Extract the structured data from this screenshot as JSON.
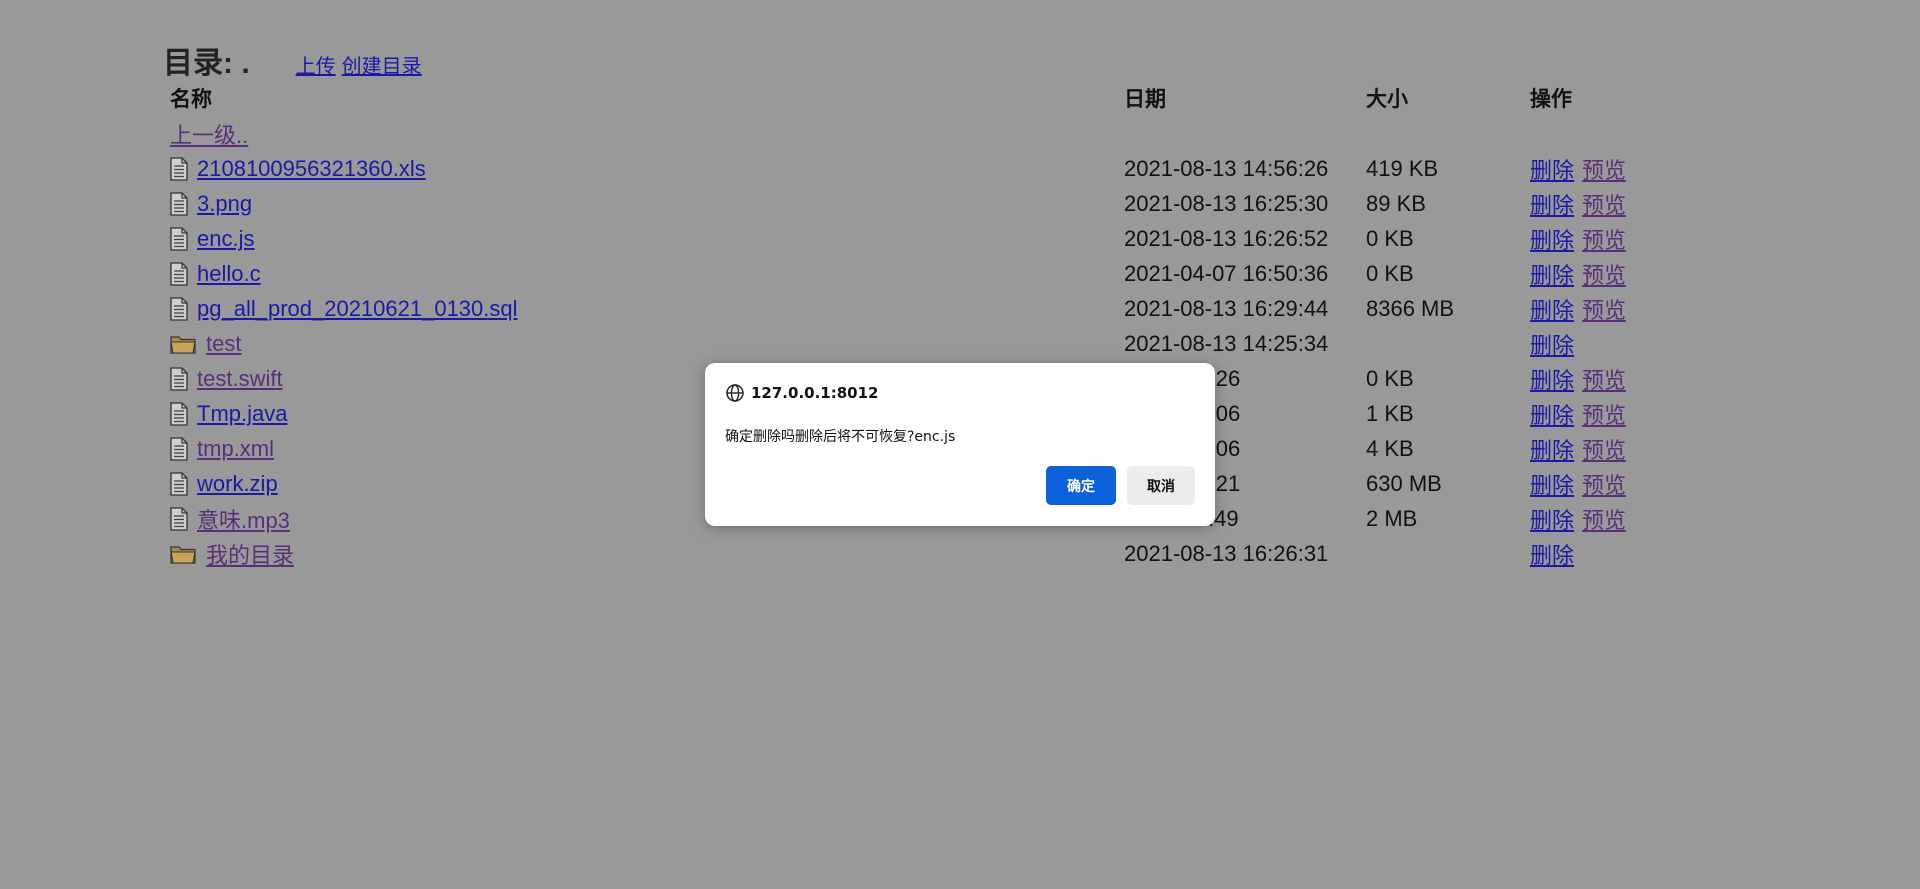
{
  "header": {
    "title": "目录: .",
    "upload_link": "上传",
    "mkdir_link": "创建目录"
  },
  "table": {
    "columns": [
      "名称",
      "日期",
      "大小",
      "操作"
    ],
    "parent_link": "上一级..",
    "rows": [
      {
        "type": "file",
        "name": "2108100956321360.xls",
        "date": "2021-08-13 14:56:26",
        "size": "419 KB",
        "delete": "删除",
        "preview": "预览",
        "visited": false
      },
      {
        "type": "file",
        "name": "3.png",
        "date": "2021-08-13 16:25:30",
        "size": "89 KB",
        "delete": "删除",
        "preview": "预览",
        "visited": false
      },
      {
        "type": "file",
        "name": "enc.js",
        "date": "2021-08-13 16:26:52",
        "size": "0 KB",
        "delete": "删除",
        "preview": "预览",
        "visited": false
      },
      {
        "type": "file",
        "name": "hello.c",
        "date": "2021-04-07 16:50:36",
        "size": "0 KB",
        "delete": "删除",
        "preview": "预览",
        "visited": false
      },
      {
        "type": "file",
        "name": "pg_all_prod_20210621_0130.sql",
        "date": "2021-08-13 16:29:44",
        "size": "8366 MB",
        "delete": "删除",
        "preview": "预览",
        "visited": false
      },
      {
        "type": "folder",
        "name": "test",
        "date": "2021-08-13 14:25:34",
        "size": "",
        "delete": "删除",
        "preview": "",
        "visited": true
      },
      {
        "type": "file",
        "name": "test.swift",
        "date": "21 09:35:26",
        "size": "0 KB",
        "delete": "删除",
        "preview": "预览",
        "visited": true
      },
      {
        "type": "file",
        "name": "Tmp.java",
        "date": "06 13:42:06",
        "size": "1 KB",
        "delete": "删除",
        "preview": "预览",
        "visited": false
      },
      {
        "type": "file",
        "name": "tmp.xml",
        "date": "06 13:42:06",
        "size": "4 KB",
        "delete": "删除",
        "preview": "预览",
        "visited": true
      },
      {
        "type": "file",
        "name": "work.zip",
        "date": "13 16:28:21",
        "size": "630 MB",
        "delete": "删除",
        "preview": "预览",
        "visited": false
      },
      {
        "type": "file",
        "name": "意味.mp3",
        "date": "11 18:39:49",
        "size": "2 MB",
        "delete": "删除",
        "preview": "预览",
        "visited": true
      },
      {
        "type": "folder",
        "name": "我的目录",
        "date": "2021-08-13 16:26:31",
        "size": "",
        "delete": "删除",
        "preview": "",
        "visited": true
      }
    ]
  },
  "dialog": {
    "origin": "127.0.0.1:8012",
    "message": "确定删除吗删除后将不可恢复?enc.js",
    "ok_label": "确定",
    "cancel_label": "取消"
  },
  "colors": {
    "background": "#999999",
    "link": "#1a1aa6",
    "visited_link": "#5a2f7a",
    "ok_button": "#0b62d8"
  }
}
